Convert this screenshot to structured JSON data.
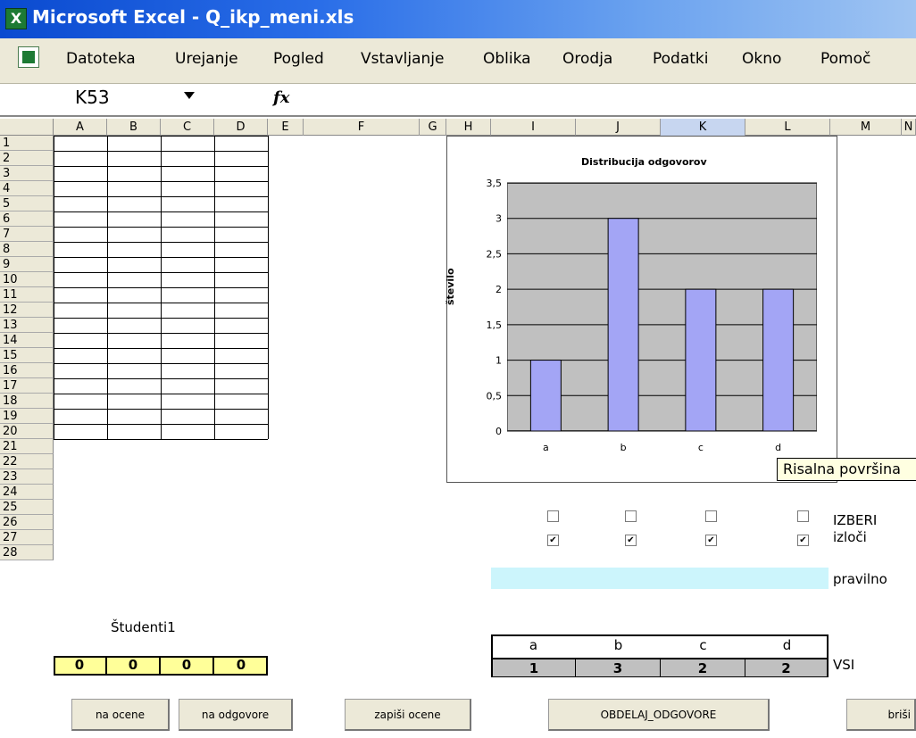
{
  "window": {
    "title": "Microsoft Excel - Q_ikp_meni.xls"
  },
  "menu": {
    "items": [
      "Datoteka",
      "Urejanje",
      "Pogled",
      "Vstavljanje",
      "Oblika",
      "Orodja",
      "Podatki",
      "Okno",
      "Pomoč"
    ]
  },
  "formula_bar": {
    "name_box": "K53",
    "fx": "fx",
    "value": ""
  },
  "columns": [
    "A",
    "B",
    "C",
    "D",
    "E",
    "F",
    "G",
    "H",
    "I",
    "J",
    "K",
    "L",
    "M",
    "N"
  ],
  "selected_column": "K",
  "rows": [
    "1",
    "2",
    "3",
    "4",
    "5",
    "6",
    "7",
    "8",
    "9",
    "10",
    "11",
    "12",
    "13",
    "14",
    "15",
    "16",
    "17",
    "18",
    "19",
    "20",
    "21",
    "22",
    "23",
    "24",
    "25",
    "26",
    "27",
    "28"
  ],
  "chart_data": {
    "type": "bar",
    "title": "Distribucija odgovorov",
    "ylabel": "število",
    "categories": [
      "a",
      "b",
      "c",
      "d"
    ],
    "values": [
      1,
      3,
      2,
      2
    ],
    "ylim": [
      0,
      3.5
    ],
    "yticks": [
      "0",
      "0,5",
      "1",
      "1,5",
      "2",
      "2,5",
      "3",
      "3,5"
    ],
    "bar_color": "#a3a5f5",
    "plot_background": "#c0c0c0",
    "grid": true
  },
  "tooltip": "Risalna površina",
  "checkbox_rows": {
    "izberi_label": "IZBERI",
    "izloci_label": "izloči",
    "izberi_checked": [
      false,
      false,
      false,
      false
    ],
    "izloci_checked": [
      true,
      true,
      true,
      true
    ]
  },
  "pravilno_label": "pravilno",
  "answer_table": {
    "headers": [
      "a",
      "b",
      "c",
      "d"
    ],
    "values": [
      "1",
      "3",
      "2",
      "2"
    ],
    "row_label": "VSI"
  },
  "students": {
    "label": "Študenti1",
    "totals": [
      "0",
      "0",
      "0",
      "0"
    ]
  },
  "buttons": {
    "na_ocene": "na ocene",
    "na_odgovore": "na odgovore",
    "zapisi_ocene": "zapiši ocene",
    "obdelaj": "OBDELAJ_ODGOVORE",
    "brisi": "briši"
  }
}
